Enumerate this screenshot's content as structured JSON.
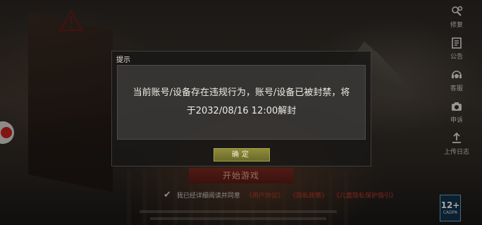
{
  "side_menu": [
    {
      "label": "修复",
      "icon": "repair-icon"
    },
    {
      "label": "公告",
      "icon": "announcement-icon"
    },
    {
      "label": "客服",
      "icon": "customer-service-icon"
    },
    {
      "label": "申诉",
      "icon": "appeal-icon"
    },
    {
      "label": "上传日志",
      "icon": "upload-log-icon"
    }
  ],
  "start_button": "开始游戏",
  "agreement": {
    "checked_text": "我已经详细阅读并同意",
    "links": [
      "《用户协议》",
      "《隐私政策》",
      "《儿童隐私保护指引》"
    ]
  },
  "age_rating": {
    "value": "12+",
    "label": "CADPA"
  },
  "dialog": {
    "title": "提示",
    "message": "当前账号/设备存在违规行为，账号/设备已被封禁，将于2032/08/16 12:00解封",
    "confirm_label": "确定"
  },
  "colors": {
    "accent_red": "#c0392b",
    "confirm_olive": "#8f8c3b"
  }
}
